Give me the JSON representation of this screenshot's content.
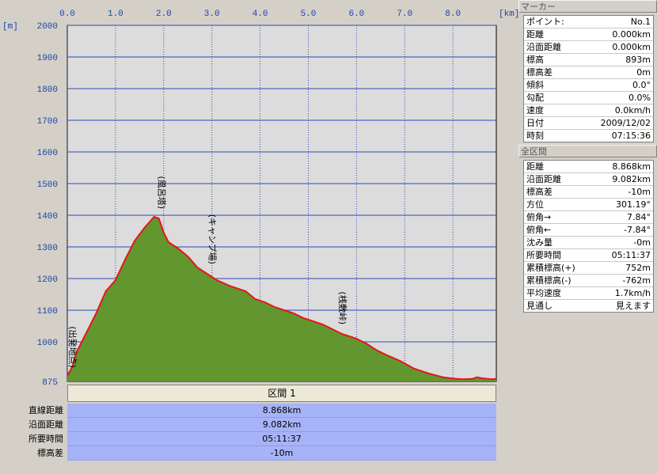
{
  "chart_data": {
    "type": "area",
    "x_unit": "[km]",
    "y_unit": "[m]",
    "xlim": [
      0.0,
      8.9
    ],
    "ylim": [
      875,
      2000
    ],
    "x_ticks": [
      "0.0",
      "1.0",
      "2.0",
      "3.0",
      "4.0",
      "5.0",
      "6.0",
      "7.0",
      "8.0"
    ],
    "y_ticks": [
      "2000",
      "1900",
      "1800",
      "1700",
      "1600",
      "1500",
      "1400",
      "1300",
      "1200",
      "1100",
      "1000",
      "875"
    ],
    "x": [
      0.0,
      0.1,
      0.2,
      0.4,
      0.6,
      0.8,
      1.0,
      1.2,
      1.4,
      1.6,
      1.8,
      1.9,
      2.0,
      2.1,
      2.3,
      2.5,
      2.7,
      2.9,
      3.1,
      3.4,
      3.7,
      3.9,
      4.1,
      4.3,
      4.5,
      4.7,
      4.9,
      5.1,
      5.3,
      5.5,
      5.7,
      5.8,
      6.0,
      6.2,
      6.4,
      6.6,
      6.9,
      7.2,
      7.5,
      7.8,
      8.0,
      8.2,
      8.4,
      8.5,
      8.6,
      8.8,
      8.9
    ],
    "y": [
      893,
      920,
      970,
      1030,
      1090,
      1160,
      1195,
      1260,
      1320,
      1360,
      1395,
      1390,
      1345,
      1315,
      1295,
      1270,
      1235,
      1215,
      1195,
      1175,
      1160,
      1135,
      1125,
      1110,
      1100,
      1090,
      1075,
      1065,
      1055,
      1040,
      1025,
      1020,
      1010,
      995,
      975,
      960,
      940,
      915,
      900,
      888,
      884,
      882,
      883,
      888,
      885,
      882,
      883
    ],
    "color": "#62962e",
    "line_color": "#e8141c",
    "annotations": [
      {
        "label": "(出発地点)",
        "x": 0.0,
        "y": 893
      },
      {
        "label": "(風呂塔)",
        "x": 1.9,
        "y": 1395
      },
      {
        "label": "(キャンプ場)",
        "x": 2.95,
        "y": 1220
      },
      {
        "label": "(桟敷峠)",
        "x": 5.65,
        "y": 1030
      }
    ]
  },
  "section": {
    "title": "区間 1",
    "rows": [
      {
        "label": "直線距離",
        "value": "8.868km"
      },
      {
        "label": "沿面距離",
        "value": "9.082km"
      },
      {
        "label": "所要時間",
        "value": "05:11:37"
      },
      {
        "label": "標高差",
        "value": "-10m"
      }
    ]
  },
  "marker": {
    "title": "マーカー",
    "rows": [
      {
        "label": "ポイント:",
        "value": "No.1"
      },
      {
        "label": "距離",
        "value": "0.000km"
      },
      {
        "label": "沿面距離",
        "value": "0.000km"
      },
      {
        "label": "標高",
        "value": "893m"
      },
      {
        "label": "標高差",
        "value": "0m"
      },
      {
        "label": "傾斜",
        "value": "0.0°"
      },
      {
        "label": "勾配",
        "value": "0.0%"
      },
      {
        "label": "速度",
        "value": "0.0km/h"
      },
      {
        "label": "日付",
        "value": "2009/12/02"
      },
      {
        "label": "時刻",
        "value": "07:15:36"
      }
    ]
  },
  "total": {
    "title": "全区間",
    "rows": [
      {
        "label": "距離",
        "value": "8.868km"
      },
      {
        "label": "沿面距離",
        "value": "9.082km"
      },
      {
        "label": "標高差",
        "value": "-10m"
      },
      {
        "label": "方位",
        "value": "301.19°"
      },
      {
        "label": "俯角→",
        "value": "7.84°"
      },
      {
        "label": "俯角←",
        "value": "-7.84°"
      },
      {
        "label": "沈み量",
        "value": "-0m"
      },
      {
        "label": "所要時間",
        "value": "05:11:37"
      },
      {
        "label": "累積標高(+)",
        "value": "752m"
      },
      {
        "label": "累積標高(-)",
        "value": "-762m"
      },
      {
        "label": "平均速度",
        "value": "1.7km/h"
      },
      {
        "label": "見通し",
        "value": "見えます"
      }
    ]
  }
}
